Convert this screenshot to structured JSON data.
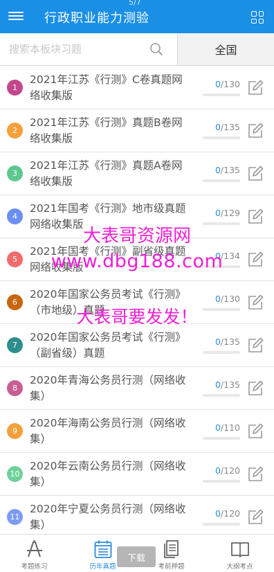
{
  "header": {
    "title": "行政职业能力测验",
    "counter": "5/7"
  },
  "search": {
    "placeholder": "搜索本板块习题",
    "scope_label": "全国"
  },
  "items": [
    {
      "num": "1",
      "name": "2021年江苏《行测》C卷真题网络收集版",
      "done": "0",
      "total": "/130",
      "progress": 0,
      "color": "#c2478e"
    },
    {
      "num": "2",
      "name": "2021年江苏《行测》真题B卷网络收集版",
      "done": "0",
      "total": "/135",
      "progress": 0,
      "color": "#f5a03c"
    },
    {
      "num": "3",
      "name": "2021年江苏《行测》真题A卷网络收集版",
      "done": "0",
      "total": "/135",
      "progress": 0,
      "color": "#5cc78f"
    },
    {
      "num": "4",
      "name": "2021年国考《行测》地市级真题网络收集版",
      "done": "0",
      "total": "/129",
      "progress": 0,
      "color": "#6b8ff0"
    },
    {
      "num": "5",
      "name": "2021年国考《行测》副省级真题网络收集版",
      "done": "0",
      "total": "/134",
      "progress": 0,
      "color": "#f06b6b"
    },
    {
      "num": "6",
      "name": "2020年国家公务员考试《行测》（市地级）真题",
      "done": "0",
      "total": "/130",
      "progress": 0,
      "color": "#c7660e"
    },
    {
      "num": "7",
      "name": "2020年国家公务员考试《行测》（副省级）真题",
      "done": "0",
      "total": "/135",
      "progress": 0,
      "color": "#2e8e8c"
    },
    {
      "num": "8",
      "name": "2020年青海公务员行测（网络收集）",
      "done": "0",
      "total": "/135",
      "progress": 0,
      "color": "#c95e95"
    },
    {
      "num": "9",
      "name": "2020年海南公务员行测（网络收集）",
      "done": "0",
      "total": "/110",
      "progress": 0,
      "color": "#f5a03c"
    },
    {
      "num": "10",
      "name": "2020年云南公务员行测（网络收集）",
      "done": "0",
      "total": "/120",
      "progress": 0,
      "color": "#6fd19a"
    },
    {
      "num": "11",
      "name": "2020年宁夏公务员行测（网络收集）",
      "done": "0",
      "total": "/120",
      "progress": 0,
      "color": "#7d9bf2"
    }
  ],
  "watermark": {
    "line1": "大表哥资源网",
    "line2": "www.dbg188.com",
    "line3": "大表哥要发发！"
  },
  "tabs": [
    {
      "label": "考题练习",
      "icon": "practice-icon"
    },
    {
      "label": "历年真题",
      "icon": "calendar-icon"
    },
    {
      "label": "考前押题",
      "icon": "document-icon"
    },
    {
      "label": "大纲考点",
      "icon": "book-icon"
    }
  ],
  "download_label": "下载",
  "colors": {
    "accent": "#1a8fe6",
    "link": "#2b8be0"
  }
}
